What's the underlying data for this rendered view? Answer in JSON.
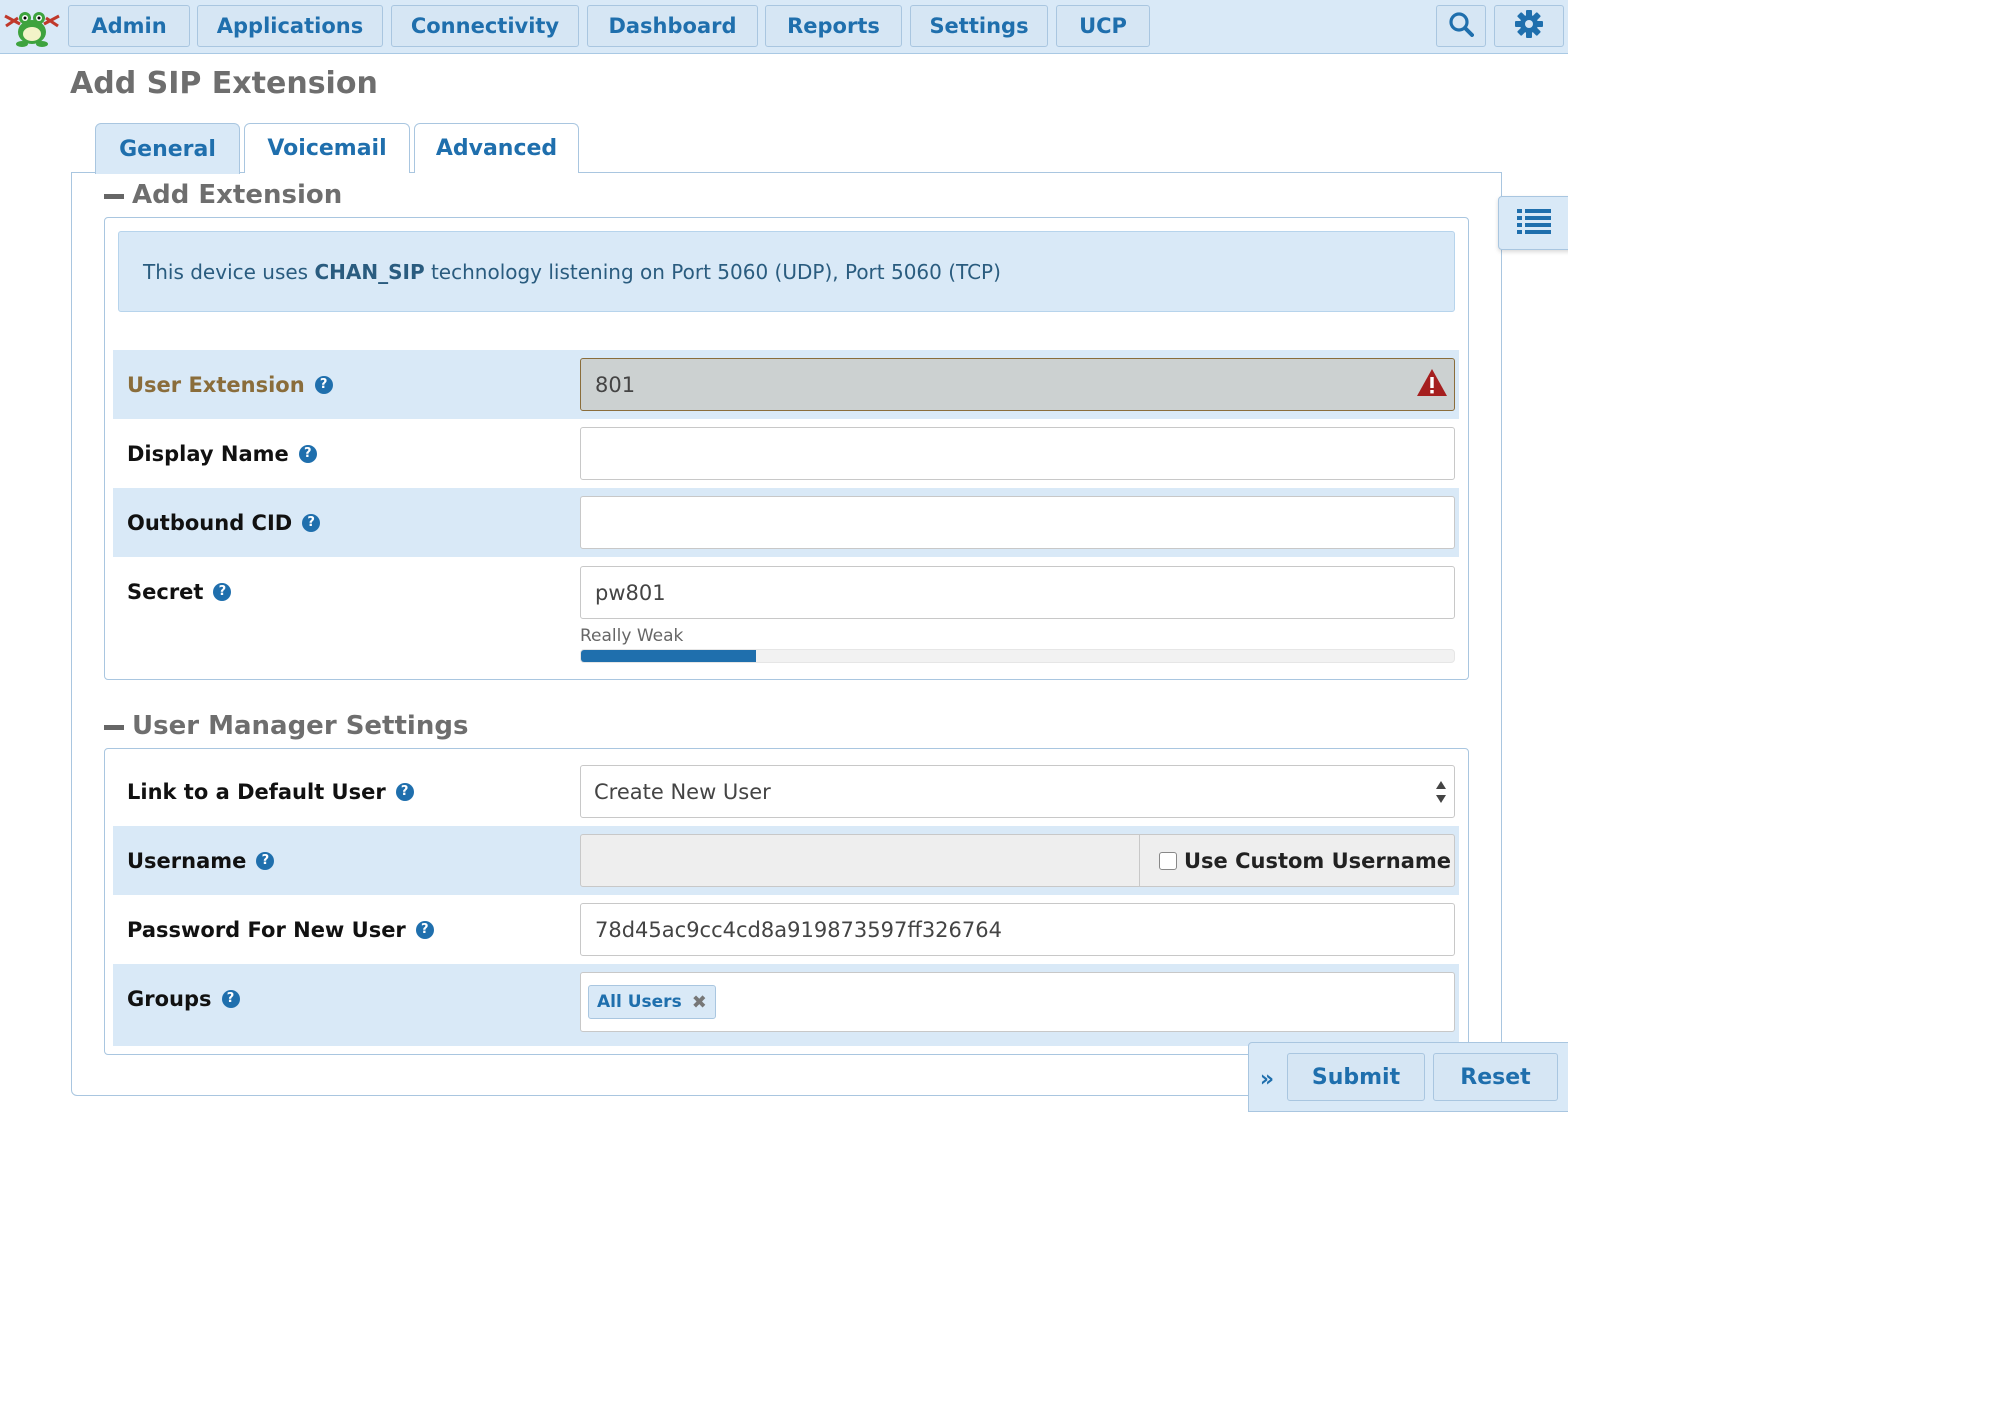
{
  "nav": {
    "items": [
      "Admin",
      "Applications",
      "Connectivity",
      "Dashboard",
      "Reports",
      "Settings",
      "UCP"
    ]
  },
  "icons": {
    "search": "search-icon",
    "settings": "gear-icon",
    "list": "list-icon",
    "logo": "frog-logo"
  },
  "colors": {
    "accent": "#1f6fad",
    "panel": "#d9e9f7",
    "warning": "#a51f1f",
    "label_warn": "#8a6d3b"
  },
  "page": {
    "title": "Add SIP Extension"
  },
  "tabs": [
    "General",
    "Voicemail",
    "Advanced"
  ],
  "section_extension": {
    "heading": "Add Extension",
    "info_prefix": "This device uses ",
    "info_bold": "CHAN_SIP",
    "info_suffix": " technology listening on Port 5060 (UDP), Port 5060 (TCP)"
  },
  "fields": {
    "user_extension": {
      "label": "User Extension",
      "value": "801"
    },
    "display_name": {
      "label": "Display Name",
      "value": ""
    },
    "outbound_cid": {
      "label": "Outbound CID",
      "value": ""
    },
    "secret": {
      "label": "Secret",
      "value": "pw801",
      "strength_label": "Really Weak",
      "strength_fraction": 0.2
    }
  },
  "section_user": {
    "heading": "User Manager Settings",
    "link_user": {
      "label": "Link to a Default User",
      "value": "Create New User"
    },
    "username": {
      "label": "Username",
      "value": "",
      "custom_label": "Use Custom Username"
    },
    "password": {
      "label": "Password For New User",
      "value": "78d45ac9cc4cd8a919873597ff326764"
    },
    "groups": {
      "label": "Groups",
      "tags": [
        "All Users"
      ]
    }
  },
  "actions": {
    "submit": "Submit",
    "reset": "Reset",
    "expand": "»"
  }
}
